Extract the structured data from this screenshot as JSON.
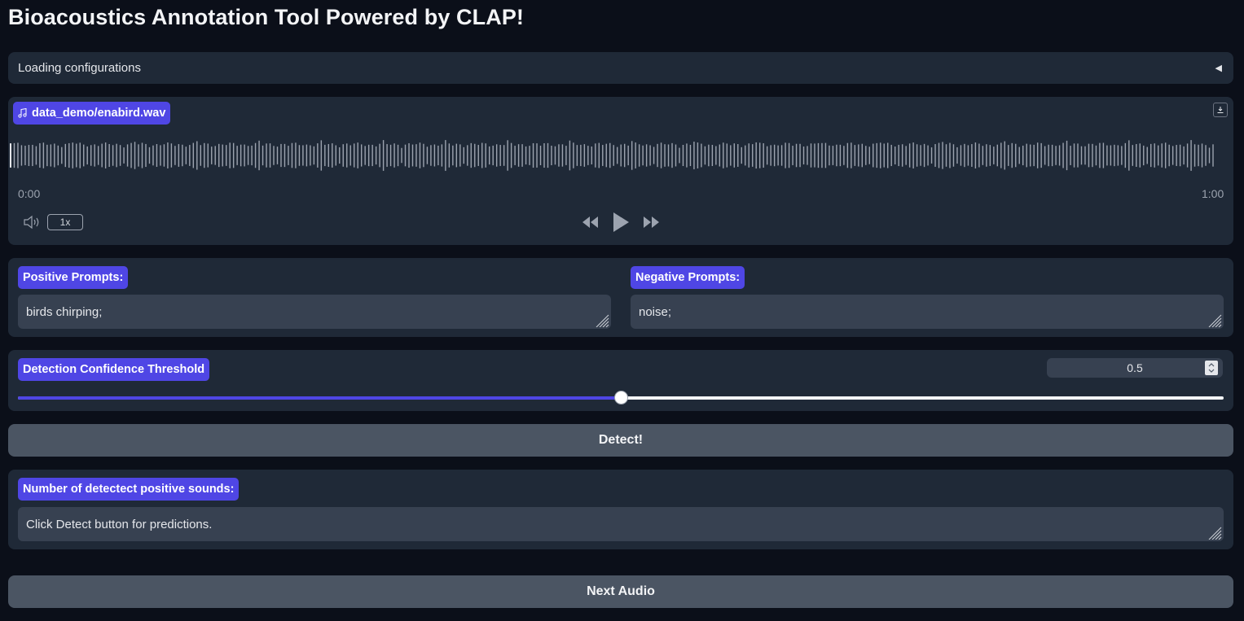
{
  "app": {
    "title": "Bioacoustics Annotation Tool Powered by CLAP!"
  },
  "accordion": {
    "label": "Loading configurations",
    "arrow": "◀"
  },
  "audio": {
    "filename": "data_demo/enabird.wav",
    "time_start": "0:00",
    "time_end": "1:00",
    "playback_rate": "1x",
    "icons": [
      "music-icon",
      "download-icon",
      "volume-icon",
      "rewind-icon",
      "play-icon",
      "fast-forward-icon"
    ]
  },
  "prompts": {
    "positive_label": "Positive Prompts:",
    "positive_value": "birds chirping;",
    "negative_label": "Negative Prompts:",
    "negative_value": "noise;"
  },
  "threshold": {
    "label": "Detection Confidence Threshold",
    "value": "0.5",
    "fraction": 0.5
  },
  "detect_button": {
    "label": "Detect!"
  },
  "result": {
    "label": "Number of detectect positive sounds:",
    "value": "Click Detect button for predictions."
  },
  "next_button": {
    "label": "Next Audio"
  },
  "colors": {
    "background": "#0b0f19",
    "panel": "#1f2937",
    "accent": "#4f46e5",
    "input": "#374151",
    "button": "#4b5563"
  }
}
